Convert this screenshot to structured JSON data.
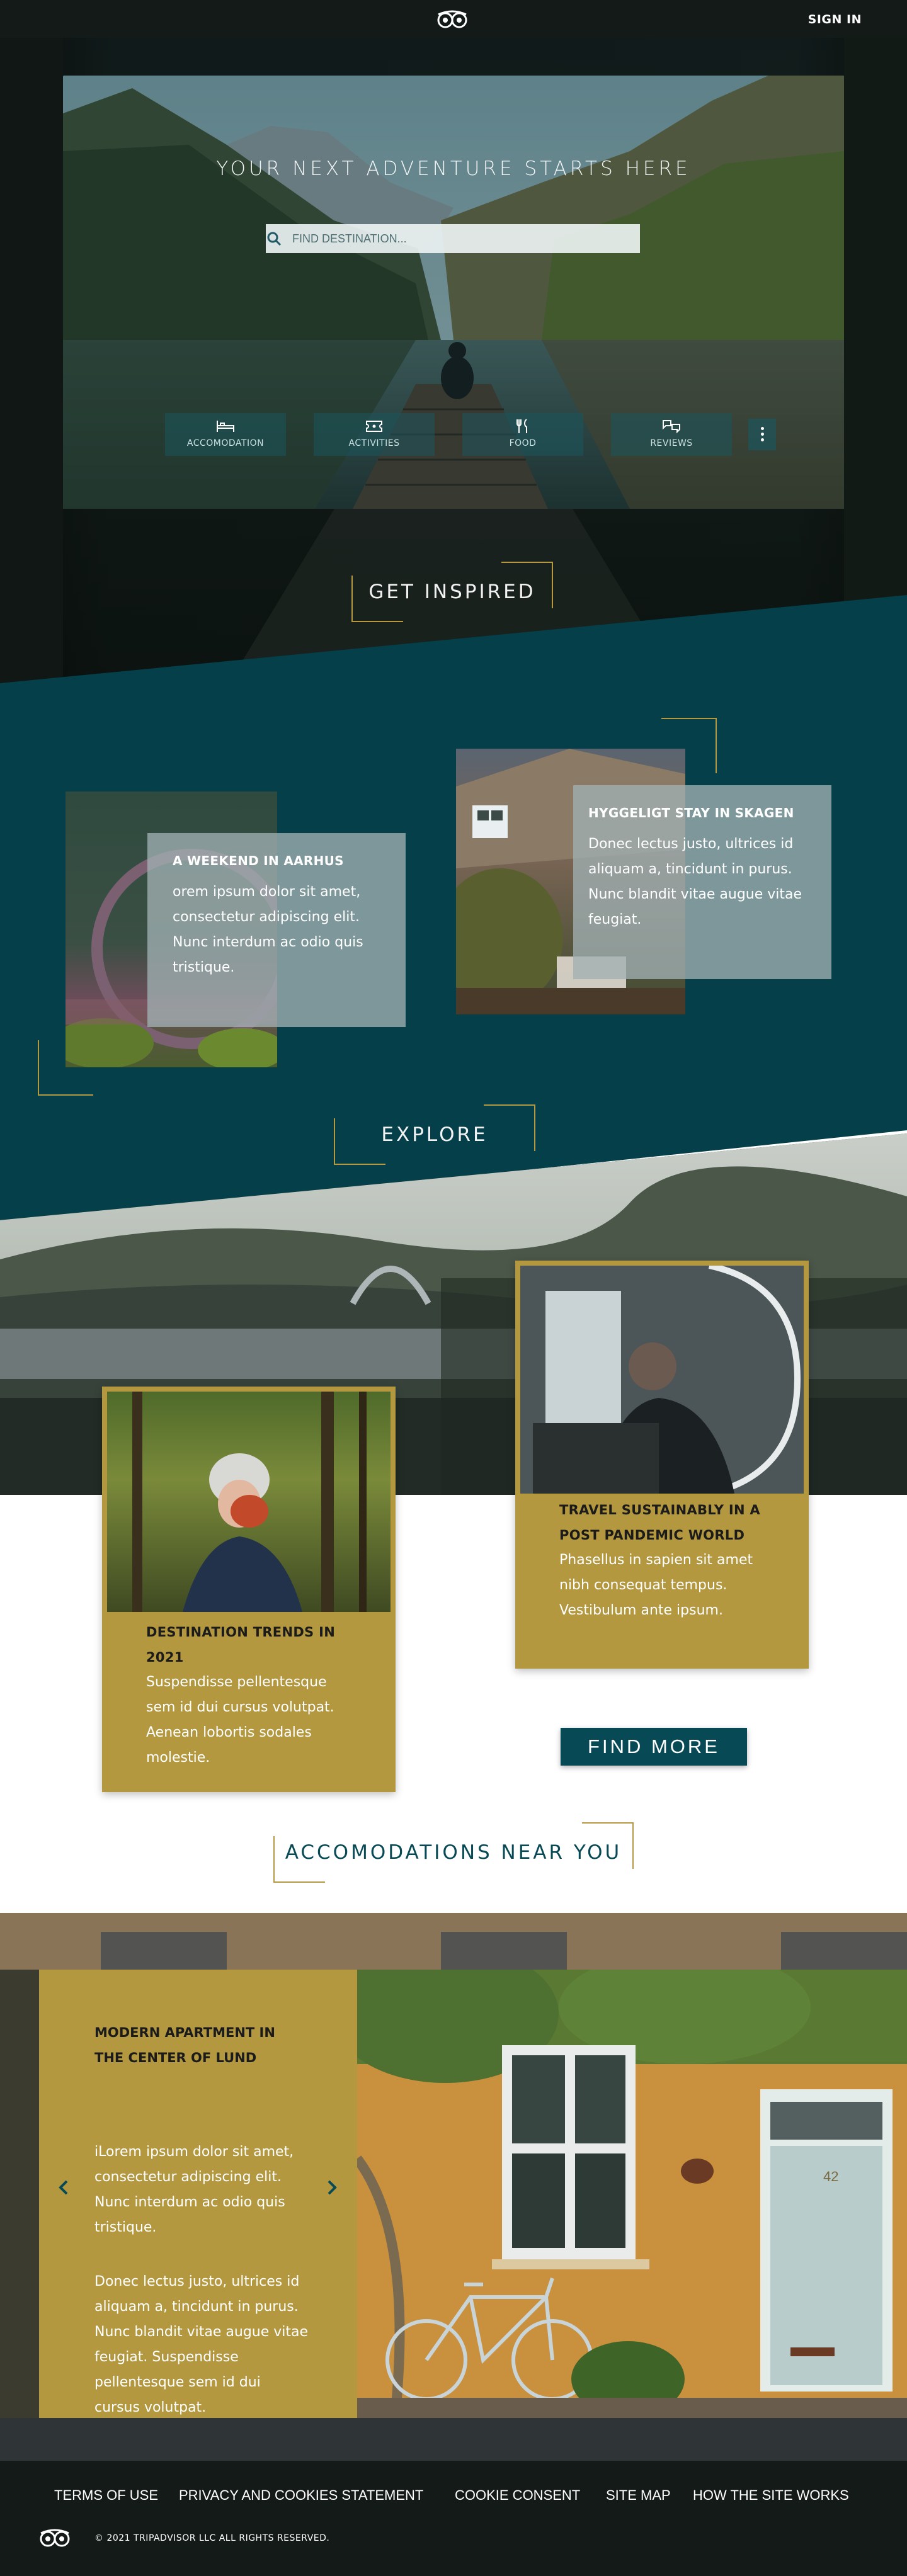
{
  "topbar": {
    "sign_in": "SIGN IN",
    "logo_icon": "owl-eyes-icon"
  },
  "hero": {
    "title": "YOUR NEXT ADVENTURE STARTS HERE",
    "search_placeholder": "FIND DESTINATION...",
    "categories": [
      {
        "label": "ACCOMODATION",
        "icon": "bed-icon"
      },
      {
        "label": "ACTIVITIES",
        "icon": "ticket-icon"
      },
      {
        "label": "FOOD",
        "icon": "fork-knife-icon"
      },
      {
        "label": "REVIEWS",
        "icon": "chat-bubbles-icon"
      }
    ],
    "more_icon": "vertical-dots-icon"
  },
  "inspired": {
    "heading": "GET INSPIRED",
    "cards": [
      {
        "title": "A WEEKEND IN AARHUS",
        "text": "orem ipsum dolor sit amet, consectetur adipiscing elit. Nunc interdum ac odio quis tristique."
      },
      {
        "title": "HYGGELIGT STAY IN SKAGEN",
        "text": "Donec lectus justo, ultrices id aliquam a, tincidunt in purus. Nunc blandit vitae augue vitae feugiat."
      }
    ]
  },
  "explore": {
    "heading": "EXPLORE",
    "cards": [
      {
        "title": "DESTINATION TRENDS IN 2021",
        "text": "Suspendisse pellentesque sem id dui cursus volutpat. Aenean lobortis sodales molestie."
      },
      {
        "title": "TRAVEL SUSTAINABLY IN A POST PANDEMIC WORLD",
        "text": "Phasellus in sapien sit amet nibh consequat tempus. Vestibulum ante ipsum."
      }
    ],
    "find_more": "FIND MORE"
  },
  "accomodations": {
    "heading": "ACCOMODATIONS NEAR YOU",
    "title": "MODERN APARTMENT IN THE CENTER OF LUND",
    "text1": "iLorem ipsum dolor sit amet, consectetur adipiscing elit. Nunc interdum ac odio quis tristique.",
    "text2": "Donec lectus justo, ultrices id aliquam a, tincidunt in purus. Nunc blandit vitae augue vitae feugiat. Suspendisse pellentesque sem id dui cursus volutpat.",
    "door_number": "42"
  },
  "footer": {
    "links": [
      "TERMS OF USE",
      "PRIVACY AND COOKIES STATEMENT",
      "COOKIE CONSENT",
      "SITE MAP",
      "HOW THE SITE WORKS"
    ],
    "copyright": "© 2021 TRIPADVISOR LLC ALL RIGHTS RESERVED."
  },
  "colors": {
    "teal": "#053f4a",
    "gold": "#b4983f",
    "dark": "#141a17",
    "button_teal": "#074a56"
  }
}
